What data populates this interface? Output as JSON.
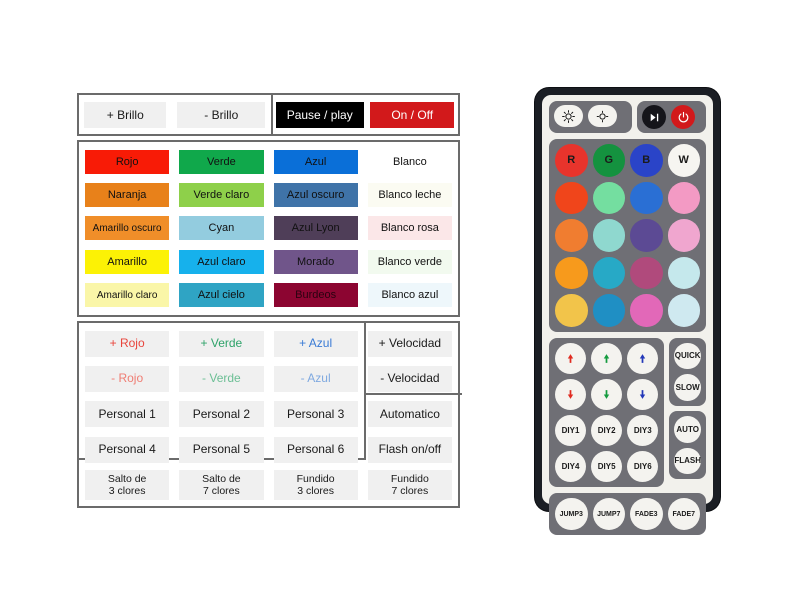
{
  "toolbar": {
    "buttons": [
      {
        "label": "+ Brillo",
        "style": "light"
      },
      {
        "label": "- Brillo",
        "style": "light"
      },
      {
        "label": "Pause / play",
        "style": "dark"
      },
      {
        "label": "On / Off",
        "style": "red"
      }
    ]
  },
  "colors": {
    "rows": [
      [
        {
          "label": "Rojo",
          "bg": "#f81b06",
          "fg": "#111111"
        },
        {
          "label": "Verde",
          "bg": "#10a84b",
          "fg": "#111111"
        },
        {
          "label": "Azul",
          "bg": "#0a6fd8",
          "fg": "#111111"
        },
        {
          "label": "Blanco",
          "bg": "#ffffff",
          "fg": "#111111"
        }
      ],
      [
        {
          "label": "Naranja",
          "bg": "#e8811a",
          "fg": "#111111"
        },
        {
          "label": "Verde claro",
          "bg": "#8ed04a",
          "fg": "#111111"
        },
        {
          "label": "Azul oscuro",
          "bg": "#3f73a8",
          "fg": "#111111"
        },
        {
          "label": "Blanco leche",
          "bg": "#fbfbf2",
          "fg": "#111111"
        }
      ],
      [
        {
          "label": "Amarillo oscuro",
          "bg": "#f08e29",
          "fg": "#111111"
        },
        {
          "label": "Cyan",
          "bg": "#93ccdf",
          "fg": "#111111"
        },
        {
          "label": "Azul Lyon",
          "bg": "#4f3e58",
          "fg": "#111111"
        },
        {
          "label": "Blanco rosa",
          "bg": "#fbe7e8",
          "fg": "#111111"
        }
      ],
      [
        {
          "label": "Amarillo",
          "bg": "#fcf205",
          "fg": "#111111"
        },
        {
          "label": "Azul claro",
          "bg": "#16b1ec",
          "fg": "#111111"
        },
        {
          "label": "Morado",
          "bg": "#70558a",
          "fg": "#111111"
        },
        {
          "label": "Blanco verde",
          "bg": "#f2faef",
          "fg": "#111111"
        }
      ],
      [
        {
          "label": "Amarillo claro",
          "bg": "#faf6a8",
          "fg": "#111111"
        },
        {
          "label": "Azul cielo",
          "bg": "#2fa4c4",
          "fg": "#111111"
        },
        {
          "label": "Burdeos",
          "bg": "#8c0531",
          "fg": "#2a0210"
        },
        {
          "label": "Blanco azul",
          "bg": "#eef7fb",
          "fg": "#111111"
        }
      ]
    ]
  },
  "functions": {
    "rows": [
      [
        {
          "label": "+ Rojo",
          "fg": "#e8453c"
        },
        {
          "label": "+ Verde",
          "fg": "#2fa36a"
        },
        {
          "label": "+ Azul",
          "fg": "#3a7bd5"
        },
        {
          "label": "+ Velocidad",
          "fg": "#1a1a1a"
        }
      ],
      [
        {
          "label": "- Rojo",
          "fg": "#ef7d73"
        },
        {
          "label": "- Verde",
          "fg": "#6cbf95"
        },
        {
          "label": "- Azul",
          "fg": "#7fa9e0"
        },
        {
          "label": "- Velocidad",
          "fg": "#1a1a1a"
        }
      ],
      [
        {
          "label": "Personal 1",
          "fg": "#1a1a1a"
        },
        {
          "label": "Personal 2",
          "fg": "#1a1a1a"
        },
        {
          "label": "Personal 3",
          "fg": "#1a1a1a"
        },
        {
          "label": "Automatico",
          "fg": "#1a1a1a"
        }
      ],
      [
        {
          "label": "Personal 4",
          "fg": "#1a1a1a"
        },
        {
          "label": "Personal 5",
          "fg": "#1a1a1a"
        },
        {
          "label": "Personal 6",
          "fg": "#1a1a1a"
        },
        {
          "label": "Flash on/off",
          "fg": "#1a1a1a"
        }
      ],
      [
        {
          "label": "Salto de\n3 clores",
          "fg": "#1a1a1a"
        },
        {
          "label": "Salto de\n7 clores",
          "fg": "#1a1a1a"
        },
        {
          "label": "Fundido\n3 clores",
          "fg": "#1a1a1a"
        },
        {
          "label": "Fundido\n7 clores",
          "fg": "#1a1a1a"
        }
      ]
    ]
  },
  "remote": {
    "top_row": {
      "brightness_up": "brightness-up-icon",
      "brightness_down": "brightness-down-icon",
      "play_pause": "play-pause-icon",
      "power": "power-icon"
    },
    "rgbw_row": [
      {
        "label": "R",
        "bg": "#e8342c"
      },
      {
        "label": "G",
        "bg": "#14923f"
      },
      {
        "label": "B",
        "bg": "#2a44c8"
      },
      {
        "label": "W",
        "bg": "#f6f5f1"
      }
    ],
    "color_rows": [
      [
        "#f0451b",
        "#74dea0",
        "#2a6fd4",
        "#f39ac4"
      ],
      [
        "#f07d30",
        "#8fd8cf",
        "#5c4a94",
        "#f0a6cf"
      ],
      [
        "#f79a1c",
        "#27a9c6",
        "#b04a7c",
        "#c5e8ec"
      ],
      [
        "#f2c44a",
        "#1f8fc4",
        "#e268b8",
        "#cfe9f0"
      ]
    ],
    "arrow_rows": [
      [
        {
          "dir": "up",
          "color": "#e02b20"
        },
        {
          "dir": "up",
          "color": "#149b3e"
        },
        {
          "dir": "up",
          "color": "#2338b8"
        }
      ],
      [
        {
          "dir": "down",
          "color": "#e02b20"
        },
        {
          "dir": "down",
          "color": "#149b3e"
        },
        {
          "dir": "down",
          "color": "#2338b8"
        }
      ]
    ],
    "speed_buttons": [
      "QUICK",
      "SLOW"
    ],
    "diy_rows": [
      [
        "DIY1",
        "DIY2",
        "DIY3"
      ],
      [
        "DIY4",
        "DIY5",
        "DIY6"
      ]
    ],
    "mode_buttons": [
      "AUTO",
      "FLASH"
    ],
    "bottom_buttons": [
      "JUMP3",
      "JUMP7",
      "FADE3",
      "FADE7"
    ]
  }
}
